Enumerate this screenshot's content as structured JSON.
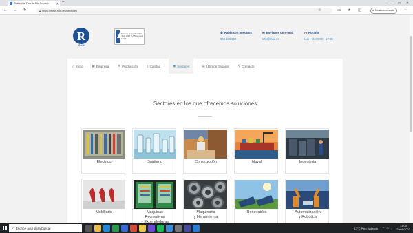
{
  "browser": {
    "tab_title": "Calderería Fina de Alta Precisió",
    "url": "https://www.roku.es/sectores",
    "sync_label": "No sincronizando"
  },
  "header": {
    "logo_text": "R",
    "logo_sub": "OKU",
    "certificate_text": "Sistema de Gestión ISO 9001:2015 TÜVRheinland CERT",
    "contacts": [
      {
        "label": "Habla con nosotros",
        "value": "946 339 992",
        "icon": "phone-icon"
      },
      {
        "label": "Envíanos un e-mail",
        "value": "info@roku.es",
        "icon": "mail-icon"
      },
      {
        "label": "Horario",
        "value": "Lun - Vier 8:00 - 17:00",
        "icon": "clock-icon"
      }
    ]
  },
  "nav": {
    "items": [
      {
        "label": "Inicio",
        "icon": "home-icon",
        "glyph": "⌂"
      },
      {
        "label": "Empresa",
        "icon": "building-icon",
        "glyph": "▦"
      },
      {
        "label": "Producción",
        "icon": "gears-icon",
        "glyph": "✲"
      },
      {
        "label": "Calidad",
        "icon": "search-icon",
        "glyph": "⌕"
      },
      {
        "label": "Sectores",
        "icon": "circle-icon",
        "glyph": "◉"
      },
      {
        "label": "Últimos trabajos",
        "icon": "gallery-icon",
        "glyph": "▤"
      },
      {
        "label": "Contacto",
        "icon": "location-icon",
        "glyph": "⚲"
      }
    ],
    "active": "Sectores"
  },
  "main": {
    "headline": "Sectores en los que ofrecemos soluciones",
    "sectors": [
      {
        "label": "Electrico"
      },
      {
        "label": "Sanitario"
      },
      {
        "label": "Construcción"
      },
      {
        "label": "Naval"
      },
      {
        "label": "Ingeniería"
      },
      {
        "label": "Mobiliario"
      },
      {
        "label": "Maquinas\nRecreativas\ny Expendedoras"
      },
      {
        "label": "Maquinaria\ny Herramienta"
      },
      {
        "label": "Renovables"
      },
      {
        "label": "Automatización\ny Robótica"
      }
    ]
  },
  "taskbar": {
    "search_placeholder": "Escribe aquí para buscar",
    "weather": "13°C  Parc. soleado",
    "time": "11:05",
    "date": "29/08/2022"
  }
}
